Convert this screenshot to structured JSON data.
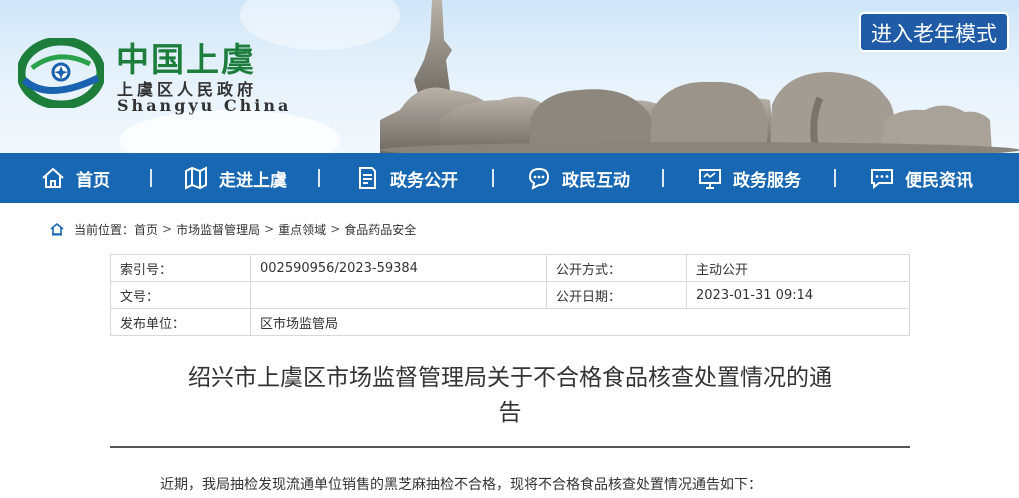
{
  "header": {
    "logo_title": "中国上虞",
    "logo_subtitle": "上虞区人民政府",
    "logo_english": "Shangyu China",
    "elder_mode_button": "进入老年模式",
    "colors": {
      "nav_blue": "#1767b2",
      "elder_button": "#1f5ba6",
      "logo_green": "#1d7d3b"
    }
  },
  "nav": {
    "items": [
      {
        "label": "首页",
        "icon": "home-icon"
      },
      {
        "label": "走进上虞",
        "icon": "map-icon"
      },
      {
        "label": "政务公开",
        "icon": "document-icon"
      },
      {
        "label": "政民互动",
        "icon": "chat-bubble-icon"
      },
      {
        "label": "政务服务",
        "icon": "monitor-icon"
      },
      {
        "label": "便民资讯",
        "icon": "message-icon"
      }
    ]
  },
  "breadcrumb": {
    "prefix": "当前位置：",
    "items": [
      "首页",
      "市场监督管理局",
      "重点领域",
      "食品药品安全"
    ],
    "separator": ">"
  },
  "info": {
    "index_label": "索引号：",
    "index_value": "002590956/2023-59384",
    "open_method_label": "公开方式：",
    "open_method_value": "主动公开",
    "doc_no_label": "文号：",
    "doc_no_value": "",
    "open_date_label": "公开日期：",
    "open_date_value": "2023-01-31 09:14",
    "publisher_label": "发布单位：",
    "publisher_value": "区市场监管局"
  },
  "article": {
    "title_line1": "绍兴市上虞区市场监督管理局关于不合格食品核查处置情况的通",
    "title_line2": "告",
    "first_paragraph": "近期，我局抽检发现流通单位销售的黑芝麻抽检不合格，现将不合格食品核查处置情况通告如下："
  }
}
